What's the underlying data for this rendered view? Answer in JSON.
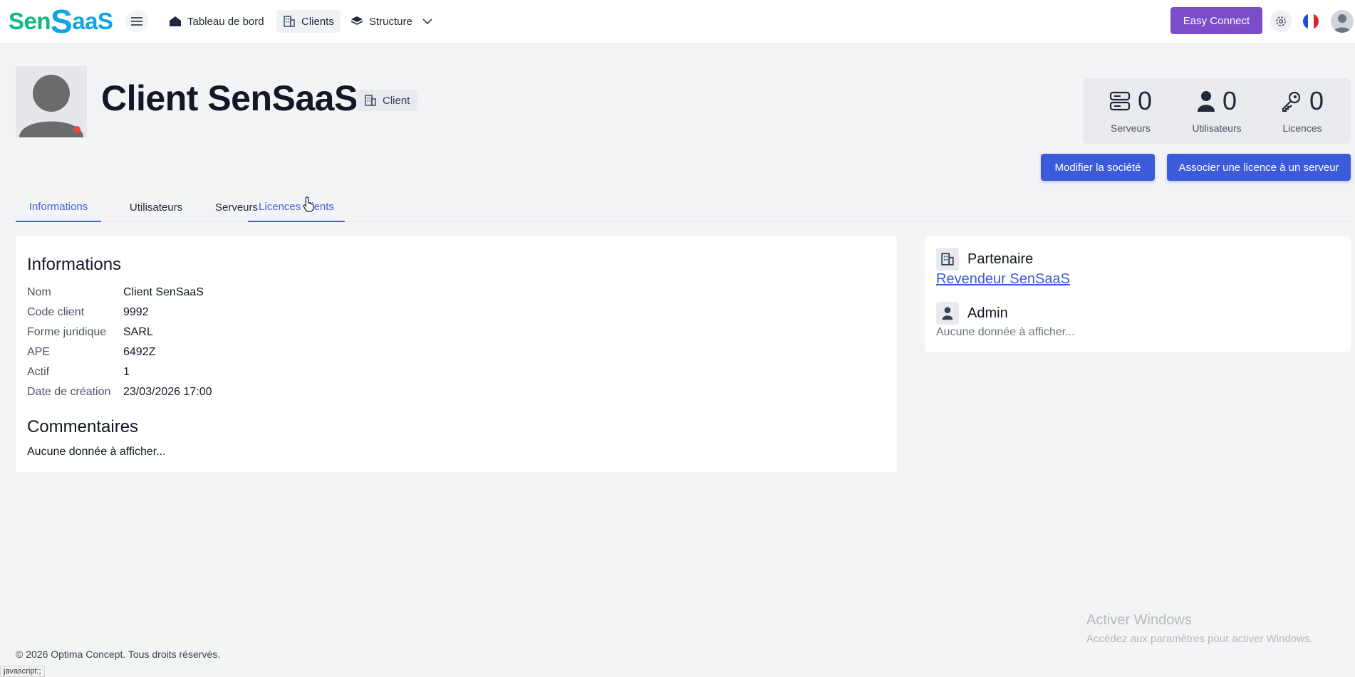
{
  "brand": {
    "part1": "Sen",
    "part2": "S",
    "part3": "aaS"
  },
  "nav": {
    "dashboard": "Tableau de bord",
    "clients": "Clients",
    "structure": "Structure",
    "easy_connect": "Easy Connect"
  },
  "colors": {
    "accent": "#3b5bdb",
    "purple": "#7c4dca",
    "brand_green": "#10b981",
    "brand_blue": "#0ea5e9"
  },
  "header": {
    "title": "Client SenSaaS",
    "badge": "Client"
  },
  "stats": [
    {
      "value": "0",
      "label": "Serveurs"
    },
    {
      "value": "0",
      "label": "Utilisateurs"
    },
    {
      "value": "0",
      "label": "Licences"
    }
  ],
  "actions": {
    "edit_company": "Modifier la société",
    "assign_license": "Associer une licence à un serveur"
  },
  "tabs": [
    {
      "label": "Informations"
    },
    {
      "label": "Utilisateurs"
    },
    {
      "label": "Serveurs"
    },
    {
      "label": "Licences clients"
    }
  ],
  "info": {
    "title": "Informations",
    "rows": [
      {
        "key": "Nom",
        "value": "Client SenSaaS"
      },
      {
        "key": "Code client",
        "value": "9992"
      },
      {
        "key": "Forme juridique",
        "value": "SARL"
      },
      {
        "key": "APE",
        "value": "6492Z"
      },
      {
        "key": "Actif",
        "value": "1"
      },
      {
        "key": "Date de création",
        "value": "23/03/2026 17:00"
      }
    ],
    "comments_title": "Commentaires",
    "comments_empty": "Aucune donnée à afficher..."
  },
  "side": {
    "partner_title": "Partenaire",
    "partner_link": "Revendeur SenSaaS",
    "admin_title": "Admin",
    "admin_empty": "Aucune donnée à afficher..."
  },
  "watermark": {
    "line1": "Activer Windows",
    "line2": "Accédez aux paramètres pour activer Windows."
  },
  "footer": "© 2026 Optima Concept. Tous droits réservés.",
  "status_bar": "javascript:;"
}
